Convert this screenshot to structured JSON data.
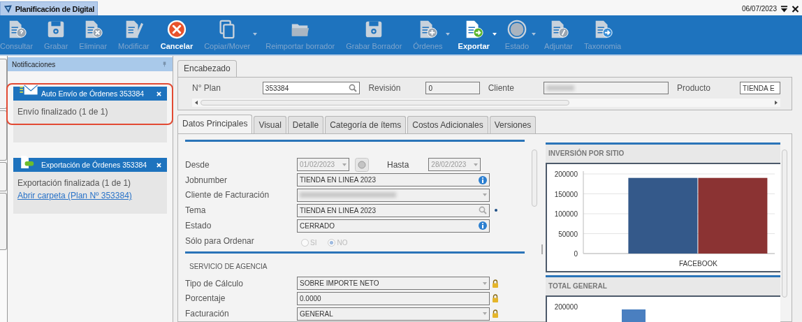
{
  "window": {
    "title": "Planificación de Digital",
    "date": "06/07/2023"
  },
  "toolbar": [
    {
      "label": "Consultar",
      "kind": "doc-question",
      "enabled": false,
      "dropdown": false
    },
    {
      "label": "Grabar",
      "kind": "disk",
      "enabled": false,
      "dropdown": false
    },
    {
      "label": "Eliminar",
      "kind": "doc-x",
      "enabled": false,
      "dropdown": false
    },
    {
      "label": "Modificar",
      "kind": "pencil",
      "enabled": false,
      "dropdown": false
    },
    {
      "label": "Cancelar",
      "kind": "cancel",
      "enabled": true,
      "dropdown": false
    },
    {
      "label": "Copiar/Mover",
      "kind": "copy",
      "enabled": false,
      "dropdown": true
    },
    {
      "label": "Reimportar borrador",
      "kind": "folder",
      "enabled": false,
      "dropdown": false
    },
    {
      "label": "Grabar Borrador",
      "kind": "disk",
      "enabled": false,
      "dropdown": false
    },
    {
      "label": "Órdenes",
      "kind": "doc-plus",
      "enabled": false,
      "dropdown": true
    },
    {
      "label": "Exportar",
      "kind": "doc-arrow",
      "enabled": true,
      "dropdown": true
    },
    {
      "label": "Estado",
      "kind": "globe",
      "enabled": false,
      "dropdown": true
    },
    {
      "label": "Adjuntar",
      "kind": "doc-clip",
      "enabled": false,
      "dropdown": false
    },
    {
      "label": "Taxonomia",
      "kind": "doc-arrow",
      "enabled": false,
      "dropdown": false
    }
  ],
  "notifications": {
    "title": "Notificaciones",
    "items": [
      {
        "kind": "mail",
        "title": "Auto Envío de Órdenes 353384",
        "message": "Envío finalizado (1 de 1)",
        "highlighted": true
      },
      {
        "kind": "pdf",
        "title": "Exportación de Órdenes 353384",
        "message": "Exportación finalizada (1 de 1)",
        "link": "Abrir carpeta (Plan Nº 353384)",
        "highlighted": false
      }
    ]
  },
  "header": {
    "tab": "Encabezado",
    "fields": [
      {
        "label": "N° Plan",
        "value": "353384",
        "kind": "search"
      },
      {
        "label": "Revisión",
        "value": "0",
        "kind": "text"
      },
      {
        "label": "Cliente",
        "kind": "redacted"
      },
      {
        "label": "Producto",
        "value": "TIENDA E",
        "kind": "text"
      }
    ]
  },
  "tabs": [
    {
      "label": "Datos Principales",
      "selected": true
    },
    {
      "label": "Visual",
      "selected": false
    },
    {
      "label": "Detalle",
      "selected": false
    },
    {
      "label": "Categoría de ítems",
      "selected": false
    },
    {
      "label": "Costos Adicionales",
      "selected": false
    },
    {
      "label": "Versiones",
      "selected": false
    }
  ],
  "form": [
    {
      "kind": "date_range",
      "label": "Desde",
      "value": "01/02/2023",
      "label2": "Hasta",
      "value2": "28/02/2023"
    },
    {
      "kind": "info",
      "label": "Jobnumber",
      "value": "TIENDA EN LINEA 2023"
    },
    {
      "kind": "redacted_dropdown",
      "label": "Cliente de Facturación"
    },
    {
      "kind": "search",
      "label": "Tema",
      "value": "TIENDA EN LINEA 2023"
    },
    {
      "kind": "info",
      "label": "Estado",
      "value": "CERRADO"
    },
    {
      "kind": "radio",
      "label": "Sólo para Ordenar",
      "options": [
        {
          "label": "SI",
          "selected": false
        },
        {
          "label": "NO",
          "selected": true
        }
      ]
    },
    {
      "kind": "section",
      "label": "SERVICIO DE AGENCIA"
    },
    {
      "kind": "locked_dropdown",
      "label": "Tipo de Cálculo",
      "value": "SOBRE IMPORTE NETO"
    },
    {
      "kind": "locked_text",
      "label": "Porcentaje",
      "value": "0.0000"
    },
    {
      "kind": "locked_dropdown",
      "label": "Facturación",
      "value": "GENERAL"
    }
  ],
  "charts": [
    {
      "title": "INVERSIÓN POR SITIO",
      "chart_data": {
        "type": "bar",
        "categories": [
          "FACEBOOK"
        ],
        "series": [
          {
            "color": "#34598a",
            "values": [
              190000
            ]
          },
          {
            "color": "#8b3333",
            "values": [
              190000
            ]
          }
        ],
        "grid": true,
        "ylim": [
          0,
          200000
        ],
        "yticks": [
          0,
          50000,
          100000,
          150000,
          200000
        ]
      }
    },
    {
      "title": "TOTAL GENERAL",
      "tick_label": "200000"
    }
  ]
}
